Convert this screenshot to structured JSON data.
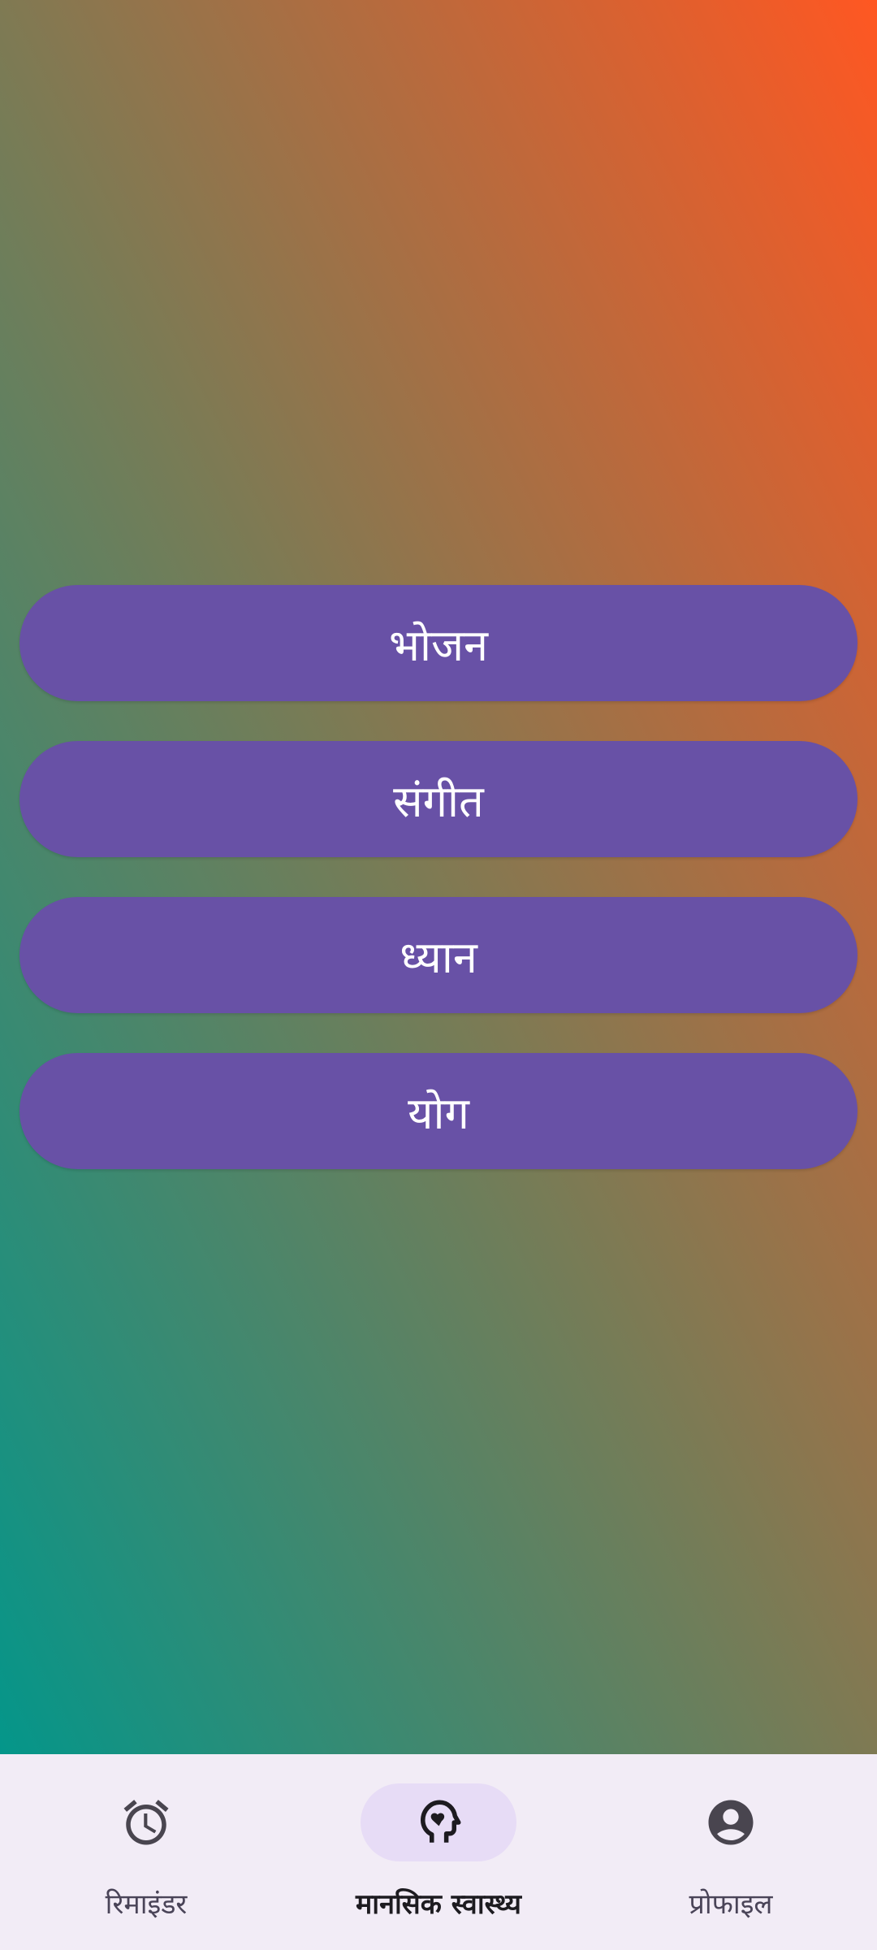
{
  "menu": {
    "buttons": [
      {
        "label": "भोजन"
      },
      {
        "label": "संगीत"
      },
      {
        "label": "ध्यान"
      },
      {
        "label": "योग"
      }
    ]
  },
  "bottom_nav": {
    "items": [
      {
        "label": "रिमाइंडर",
        "icon": "alarm-clock-icon"
      },
      {
        "label": "मानसिक स्वास्थ्य",
        "icon": "head-heart-icon",
        "active": true
      },
      {
        "label": "प्रोफाइल",
        "icon": "account-circle-icon"
      }
    ]
  },
  "colors": {
    "gradient_top_right": "#ff5722",
    "gradient_bottom_left": "#04968a",
    "button_fill": "#6851a6",
    "nav_background": "#f2ecf6",
    "nav_active_pill": "#e7dcf6"
  }
}
